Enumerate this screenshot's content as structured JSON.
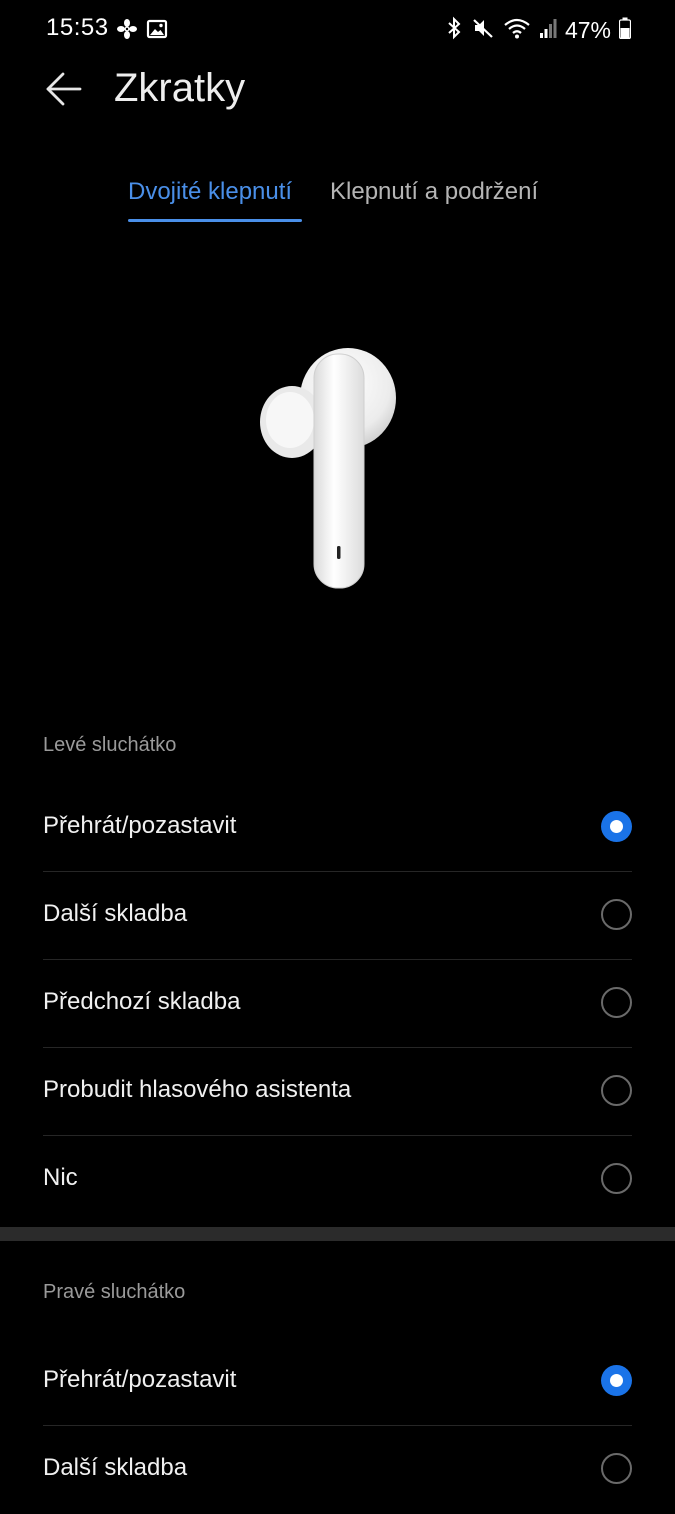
{
  "status_bar": {
    "time": "15:53",
    "left_icons": [
      "fan-icon",
      "image-icon"
    ],
    "right_icons": [
      "bluetooth-icon",
      "mute-icon",
      "wifi-icon",
      "signal-icon"
    ],
    "battery": "47%"
  },
  "header": {
    "title": "Zkratky",
    "back_icon": "arrow-left-icon"
  },
  "tabs": [
    {
      "label": "Dvojité klepnutí",
      "active": true
    },
    {
      "label": "Klepnutí a podržení",
      "active": false
    }
  ],
  "colors": {
    "accent": "#1a73e8",
    "tab_active": "#4a8fe8",
    "background": "#000000"
  },
  "left_earbud": {
    "title": "Levé sluchátko",
    "options": [
      {
        "label": "Přehrát/pozastavit",
        "selected": true
      },
      {
        "label": "Další skladba",
        "selected": false
      },
      {
        "label": "Předchozí skladba",
        "selected": false
      },
      {
        "label": "Probudit hlasového asistenta",
        "selected": false
      },
      {
        "label": "Nic",
        "selected": false
      }
    ]
  },
  "right_earbud": {
    "title": "Pravé sluchátko",
    "options": [
      {
        "label": "Přehrát/pozastavit",
        "selected": true
      },
      {
        "label": "Další skladba",
        "selected": false
      }
    ]
  }
}
